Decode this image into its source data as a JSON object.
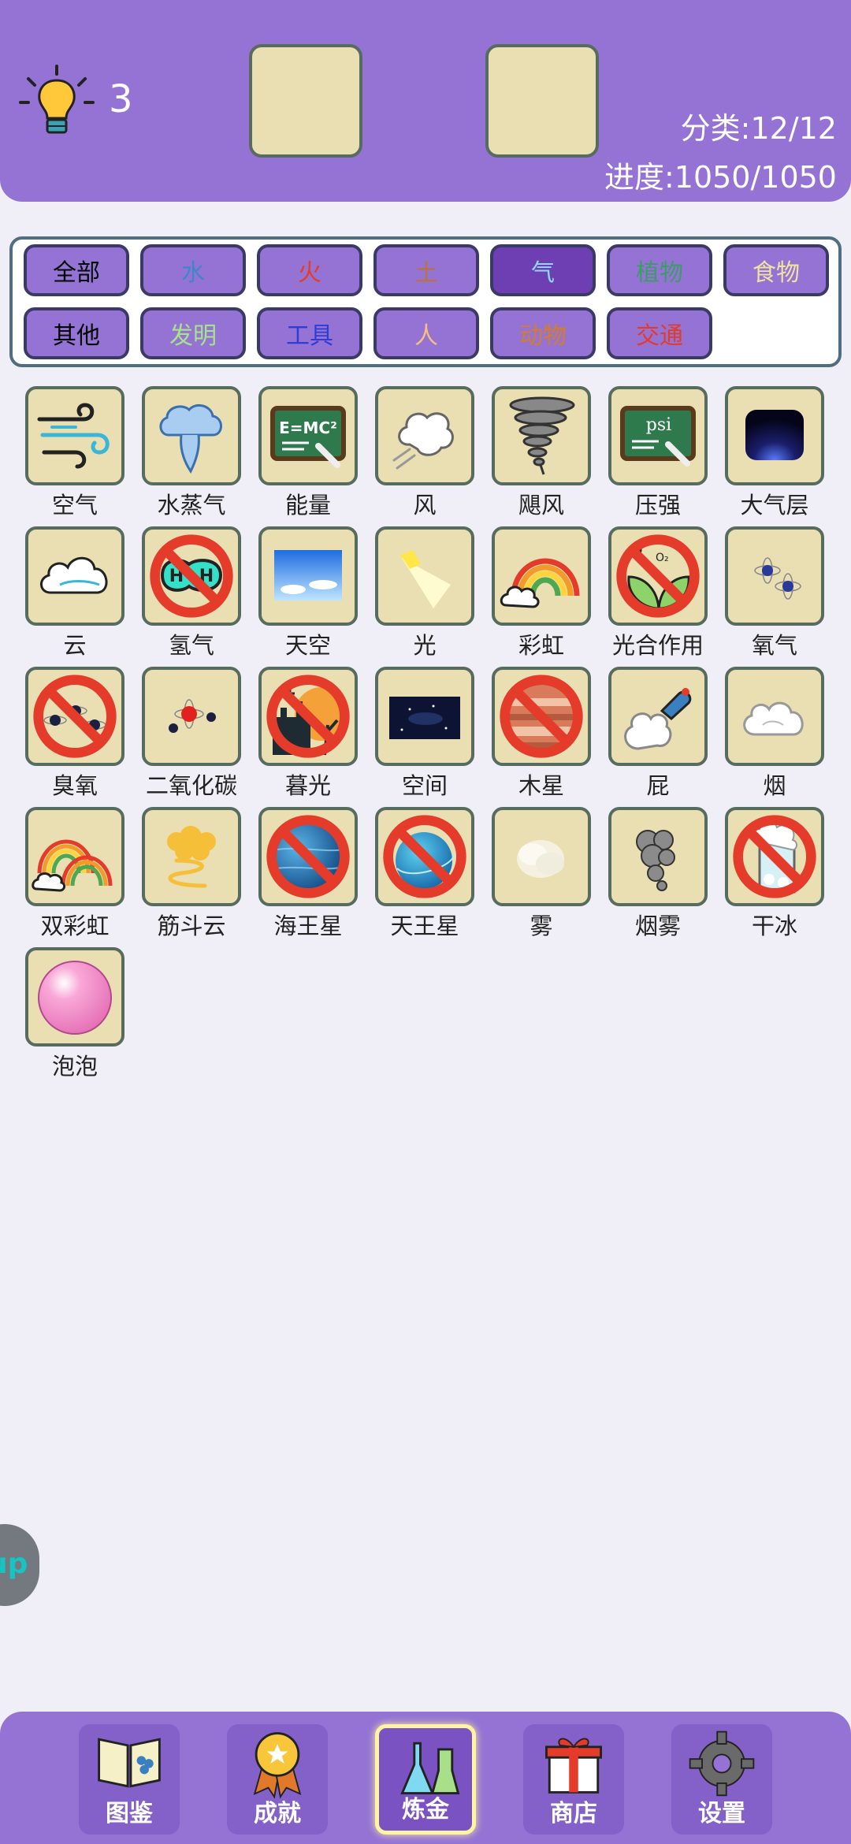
{
  "header": {
    "hint_count": "3",
    "category": "分类:12/12",
    "progress": "进度:1050/1050"
  },
  "filters": [
    {
      "label": "全部",
      "color": "#000000"
    },
    {
      "label": "水",
      "color": "#3f86c9"
    },
    {
      "label": "火",
      "color": "#e53b2a"
    },
    {
      "label": "土",
      "color": "#b9733d"
    },
    {
      "label": "气",
      "color": "#8ed9ff",
      "active": true
    },
    {
      "label": "植物",
      "color": "#3f9a6b"
    },
    {
      "label": "食物",
      "color": "#f0e2a0"
    },
    {
      "label": "其他",
      "color": "#000000"
    },
    {
      "label": "发明",
      "color": "#a6e38a"
    },
    {
      "label": "工具",
      "color": "#2e3cd8"
    },
    {
      "label": "人",
      "color": "#f6bf7e"
    },
    {
      "label": "动物",
      "color": "#d47c2c"
    },
    {
      "label": "交通",
      "color": "#e33b2a"
    }
  ],
  "items": [
    {
      "label": "空气",
      "icon": "wind-swirl-icon"
    },
    {
      "label": "水蒸气",
      "icon": "steam-icon"
    },
    {
      "label": "能量",
      "icon": "emc2-board-icon"
    },
    {
      "label": "风",
      "icon": "gust-icon"
    },
    {
      "label": "飓风",
      "icon": "tornado-icon"
    },
    {
      "label": "压强",
      "icon": "psi-board-icon"
    },
    {
      "label": "大气层",
      "icon": "atmosphere-icon"
    },
    {
      "label": "云",
      "icon": "cloud-icon"
    },
    {
      "label": "氢气",
      "icon": "hydrogen-icon",
      "banned": true
    },
    {
      "label": "天空",
      "icon": "sky-icon"
    },
    {
      "label": "光",
      "icon": "light-beam-icon"
    },
    {
      "label": "彩虹",
      "icon": "rainbow-icon"
    },
    {
      "label": "光合作用",
      "icon": "photosynthesis-icon",
      "banned": true
    },
    {
      "label": "氧气",
      "icon": "oxygen-molecule-icon"
    },
    {
      "label": "臭氧",
      "icon": "ozone-molecule-icon",
      "banned": true
    },
    {
      "label": "二氧化碳",
      "icon": "co2-molecule-icon"
    },
    {
      "label": "暮光",
      "icon": "twilight-castle-icon",
      "banned": true
    },
    {
      "label": "空间",
      "icon": "space-icon"
    },
    {
      "label": "木星",
      "icon": "jupiter-icon",
      "banned": true
    },
    {
      "label": "屁",
      "icon": "fart-icon"
    },
    {
      "label": "烟",
      "icon": "smoke-cloud-icon"
    },
    {
      "label": "双彩虹",
      "icon": "double-rainbow-icon"
    },
    {
      "label": "筋斗云",
      "icon": "magic-cloud-icon"
    },
    {
      "label": "海王星",
      "icon": "neptune-icon",
      "banned": true
    },
    {
      "label": "天王星",
      "icon": "uranus-icon",
      "banned": true
    },
    {
      "label": "雾",
      "icon": "fog-icon"
    },
    {
      "label": "烟雾",
      "icon": "smog-icon"
    },
    {
      "label": "干冰",
      "icon": "dry-ice-icon",
      "banned": true
    },
    {
      "label": "泡泡",
      "icon": "bubble-icon"
    }
  ],
  "side_button": {
    "label": "up"
  },
  "tabs": [
    {
      "label": "图鉴",
      "icon": "book-icon"
    },
    {
      "label": "成就",
      "icon": "medal-icon"
    },
    {
      "label": "炼金",
      "icon": "flask-icon",
      "active": true
    },
    {
      "label": "商店",
      "icon": "gift-icon"
    },
    {
      "label": "设置",
      "icon": "gear-icon"
    }
  ],
  "colors": {
    "accent": "#9473d4",
    "tile": "#e9dfb2",
    "background": "#f0eff8"
  }
}
